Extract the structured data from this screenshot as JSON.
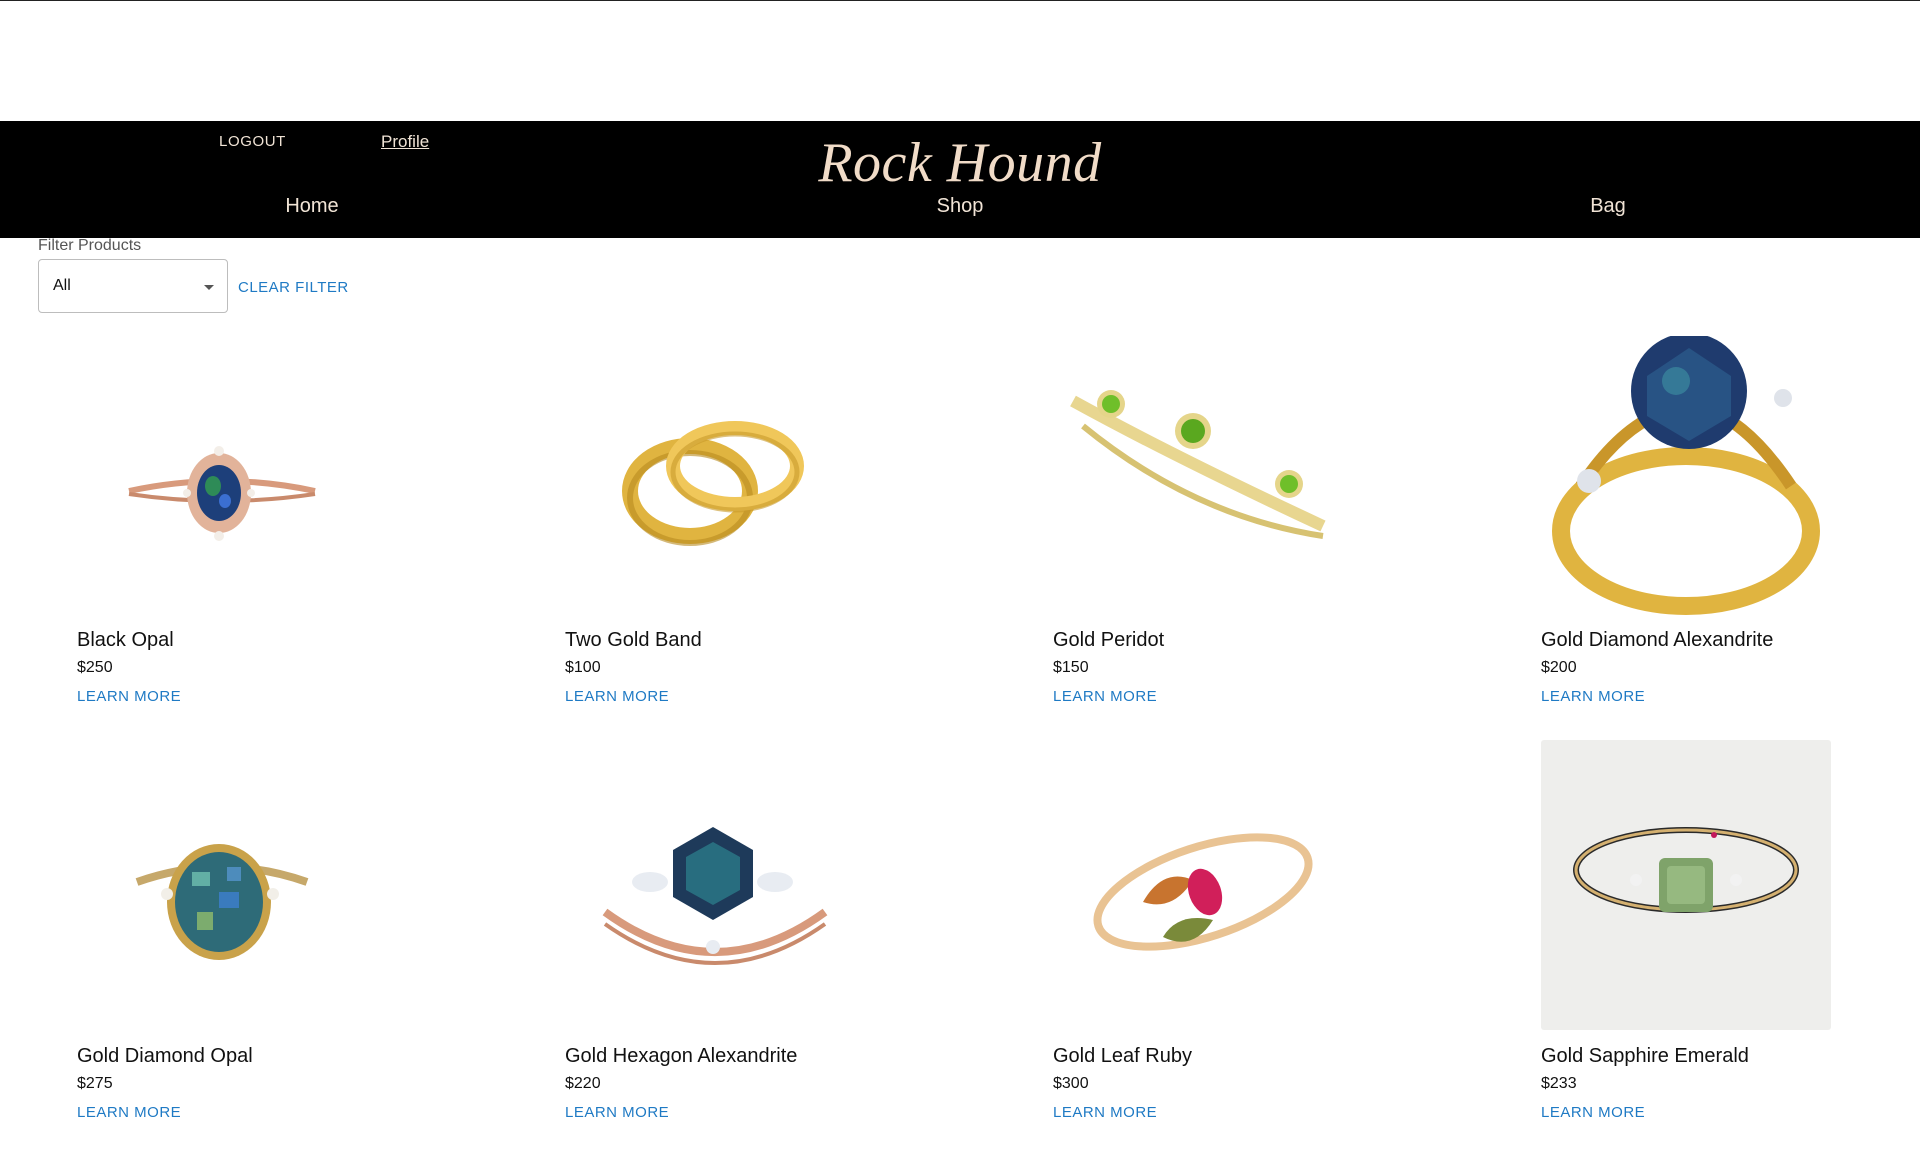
{
  "header": {
    "brand": "Rock Hound",
    "logout_label": "LOGOUT",
    "profile_label": "Profile",
    "nav": {
      "home": "Home",
      "shop": "Shop",
      "bag": "Bag"
    }
  },
  "filter": {
    "label": "Filter Products",
    "selected": "All",
    "clear_label": "CLEAR FILTER"
  },
  "products": [
    {
      "title": "Black Opal",
      "price": "$250",
      "learn_more": "LEARN MORE"
    },
    {
      "title": "Two Gold Band",
      "price": "$100",
      "learn_more": "LEARN MORE"
    },
    {
      "title": "Gold Peridot",
      "price": "$150",
      "learn_more": "LEARN MORE"
    },
    {
      "title": "Gold Diamond Alexandrite",
      "price": "$200",
      "learn_more": "LEARN MORE"
    },
    {
      "title": "Gold Diamond Opal",
      "price": "$275",
      "learn_more": "LEARN MORE"
    },
    {
      "title": "Gold Hexagon Alexandrite",
      "price": "$220",
      "learn_more": "LEARN MORE"
    },
    {
      "title": "Gold Leaf Ruby",
      "price": "$300",
      "learn_more": "LEARN MORE"
    },
    {
      "title": "Gold Sapphire Emerald",
      "price": "$233",
      "learn_more": "LEARN MORE"
    }
  ],
  "colors": {
    "navbar": "#000000",
    "nav_text": "#f1e4d6",
    "link_blue": "#1f7ac4",
    "gold": "#e0b440",
    "rose_gold": "#d89a7c"
  }
}
